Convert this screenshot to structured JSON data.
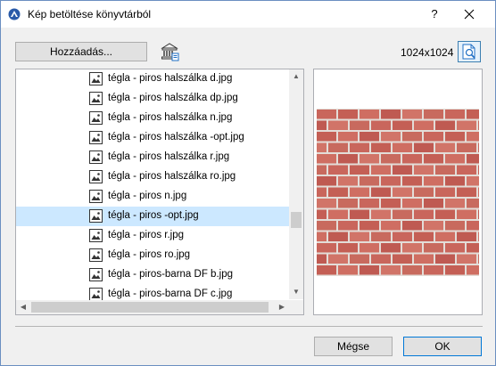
{
  "window": {
    "title": "Kép betöltése könyvtárból",
    "help_label": "?",
    "close_icon": "close-icon"
  },
  "toolbar": {
    "add_label": "Hozzáadás...",
    "library_icon": "library-icon",
    "image_size": "1024x1024",
    "preview_toggle_icon": "preview-toggle-icon"
  },
  "files": [
    {
      "name": "tégla - piros halszálka d.jpg"
    },
    {
      "name": "tégla - piros halszálka dp.jpg"
    },
    {
      "name": "tégla - piros halszálka n.jpg"
    },
    {
      "name": "tégla - piros halszálka -opt.jpg"
    },
    {
      "name": "tégla - piros halszálka r.jpg"
    },
    {
      "name": "tégla - piros halszálka ro.jpg"
    },
    {
      "name": "tégla - piros n.jpg"
    },
    {
      "name": "tégla - piros -opt.jpg",
      "selected": true
    },
    {
      "name": "tégla - piros r.jpg"
    },
    {
      "name": "tégla - piros ro.jpg"
    },
    {
      "name": "tégla - piros-barna DF b.jpg"
    },
    {
      "name": "tégla - piros-barna DF c.jpg"
    }
  ],
  "preview": {
    "image": "red-brick-texture",
    "brick_color": "#c9665c",
    "mortar_color": "#e3ddd8"
  },
  "buttons": {
    "cancel_label": "Mégse",
    "ok_label": "OK"
  },
  "colors": {
    "selection": "#cce8ff",
    "accent": "#0078d7"
  }
}
